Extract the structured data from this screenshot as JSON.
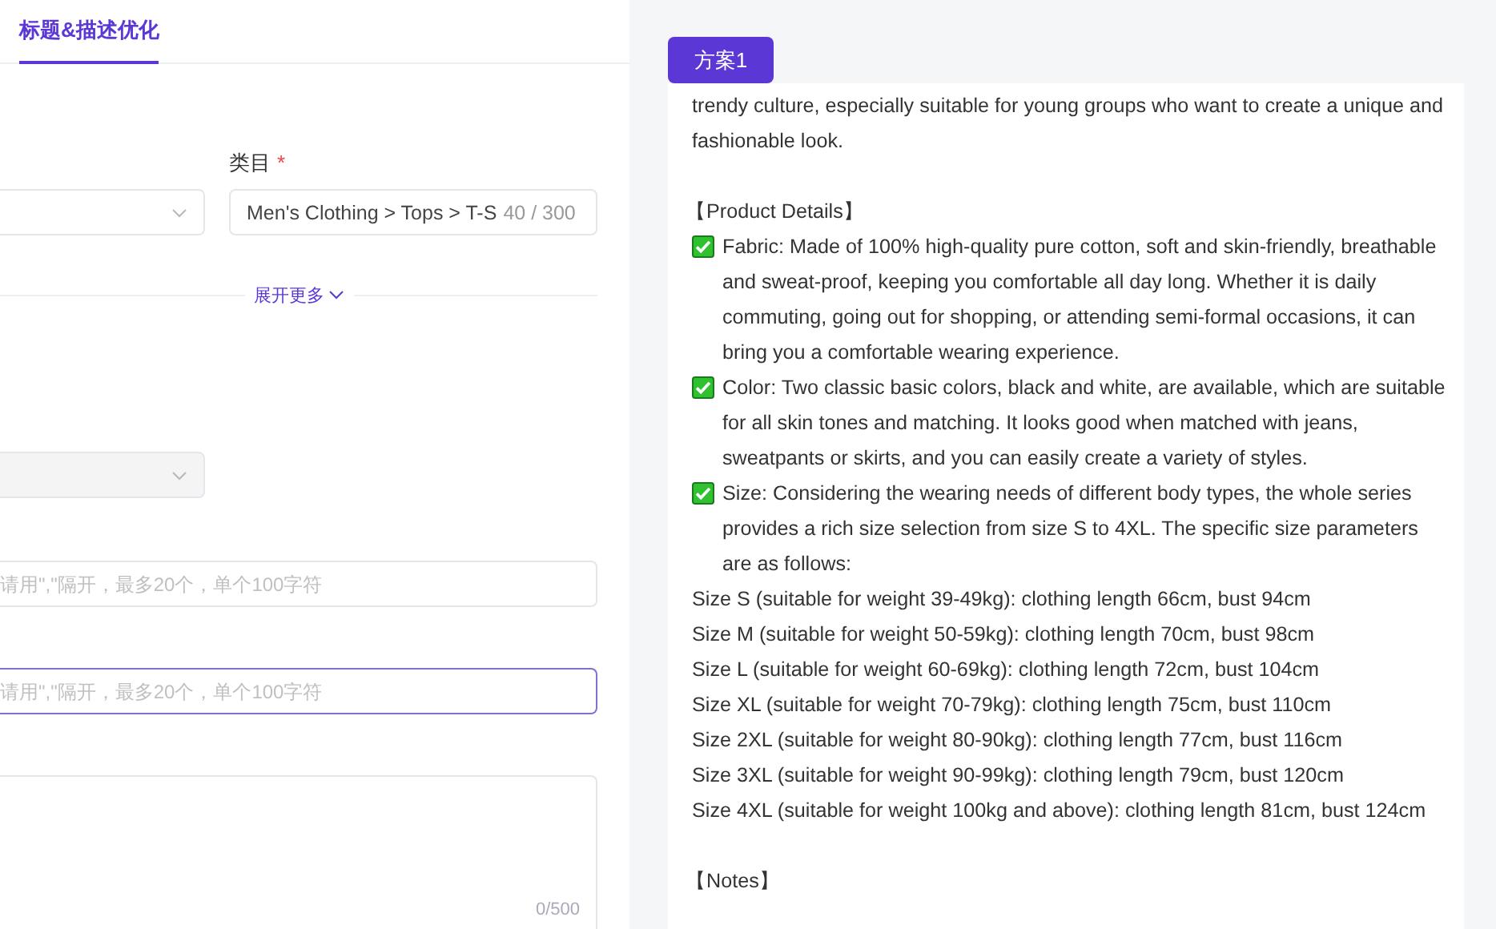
{
  "tabs": [
    {
      "label": "标题&描述优化",
      "selected": true
    }
  ],
  "form": {
    "category": {
      "label": "类目",
      "required": true,
      "required_mark": "*",
      "value": "Men's Clothing > Tops > T-S",
      "count": "40 / 300"
    },
    "expand_link": "展开更多",
    "inputs": [
      {
        "placeholder": "请用\",\"隔开，最多20个，单个100字符",
        "focused": false
      },
      {
        "placeholder": "请用\",\"隔开，最多20个，单个100字符",
        "focused": true
      }
    ],
    "textarea": {
      "count": "0/500"
    }
  },
  "result": {
    "plan_tab": "方案1",
    "paragraphs": [
      {
        "kind": "text",
        "text": "trendy culture, especially suitable for young groups who want to create a unique and fashionable look."
      },
      {
        "kind": "blank"
      },
      {
        "kind": "heading",
        "text": "【Product Details】"
      },
      {
        "kind": "check",
        "text": "Fabric: Made of 100% high-quality pure cotton, soft and skin-friendly, breathable and sweat-proof, keeping you comfortable all day long. Whether it is daily commuting, going out for shopping, or attending semi-formal occasions, it can bring you a comfortable wearing experience."
      },
      {
        "kind": "check",
        "text": "Color: Two classic basic colors, black and white, are available, which are suitable for all skin tones and matching. It looks good when matched with jeans, sweatpants or skirts, and you can easily create a variety of styles."
      },
      {
        "kind": "check",
        "text": "Size: Considering the wearing needs of different body types, the whole series provides a rich size selection from size S to 4XL. The specific size parameters are as follows:"
      },
      {
        "kind": "text",
        "text": "Size S (suitable for weight 39-49kg): clothing length 66cm, bust 94cm"
      },
      {
        "kind": "text",
        "text": "Size M (suitable for weight 50-59kg): clothing length 70cm, bust 98cm"
      },
      {
        "kind": "text",
        "text": "Size L (suitable for weight 60-69kg): clothing length 72cm, bust 104cm"
      },
      {
        "kind": "text",
        "text": "Size XL (suitable for weight 70-79kg): clothing length 75cm, bust 110cm"
      },
      {
        "kind": "text",
        "text": "Size 2XL (suitable for weight 80-90kg): clothing length 77cm, bust 116cm"
      },
      {
        "kind": "text",
        "text": "Size 3XL (suitable for weight 90-99kg): clothing length 79cm, bust 120cm"
      },
      {
        "kind": "text",
        "text": "Size 4XL (suitable for weight 100kg and above): clothing length 81cm, bust 124cm"
      },
      {
        "kind": "blank"
      },
      {
        "kind": "heading",
        "text": "【Notes】"
      }
    ]
  }
}
